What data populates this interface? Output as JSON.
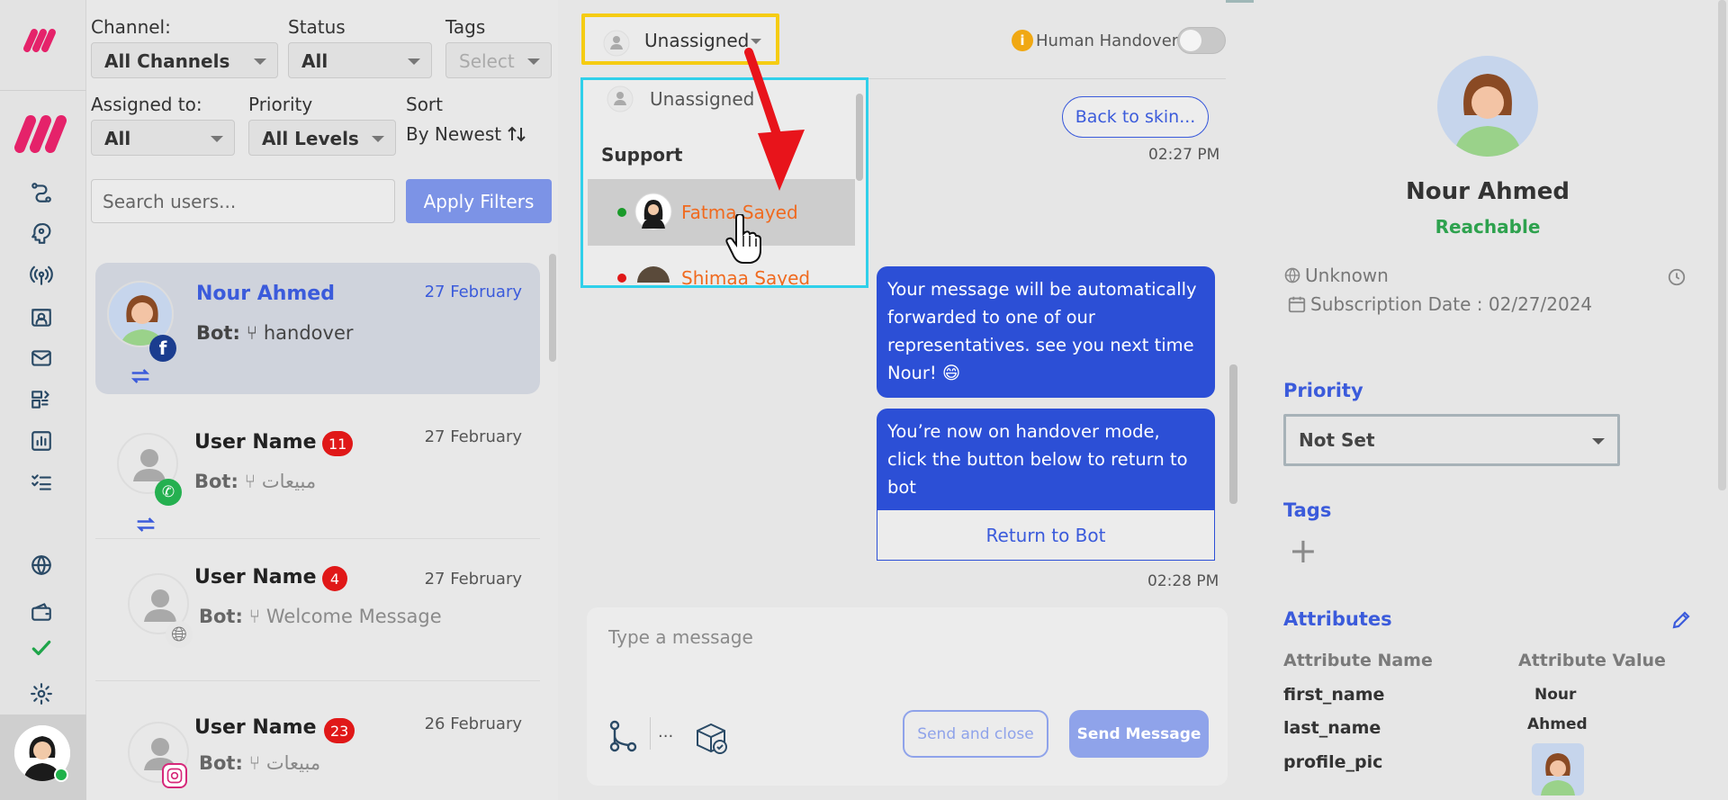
{
  "filters": {
    "channel_label": "Channel:",
    "channel_value": "All Channels",
    "status_label": "Status",
    "status_value": "All",
    "tags_label": "Tags",
    "tags_value": "Select",
    "assigned_label": "Assigned to:",
    "assigned_value": "All",
    "priority_label": "Priority",
    "priority_value": "All Levels",
    "sort_label": "Sort",
    "sort_value": "By Newest",
    "search_placeholder": "Search users...",
    "apply_label": "Apply Filters"
  },
  "conversations": [
    {
      "name": "Nour Ahmed",
      "date": "27 February",
      "bot_prefix": "Bot:",
      "bot_text": "handover",
      "channel": "facebook-icon",
      "active": true
    },
    {
      "name": "User Name",
      "date": "27 February",
      "count": "11",
      "bot_prefix": "Bot:",
      "bot_text": "مبيعات",
      "channel": "whatsapp-icon"
    },
    {
      "name": "User Name",
      "date": "27 February",
      "count": "4",
      "bot_prefix": "Bot:",
      "bot_text": "Welcome Message",
      "channel": "globe-icon"
    },
    {
      "name": "User Name",
      "date": "26 February",
      "count": "23",
      "bot_prefix": "Bot:",
      "bot_text": "مبيعات",
      "channel": "instagram-icon"
    }
  ],
  "chat": {
    "assign_value": "Unassigned",
    "handover_label": "Human Handover",
    "dropdown": {
      "unassigned": "Unassigned",
      "group": "Support",
      "agents": [
        {
          "name": "Fatma Sayed",
          "status": "online"
        },
        {
          "name": "Shimaa Sayed",
          "status": "offline"
        }
      ]
    },
    "back_button": "Back to skin...",
    "time1": "02:27 PM",
    "msg1": "Your message will be automatically forwarded to one of our representatives. see you next time Nour! 😄",
    "msg2": "You’re now on handover mode, click the button below to return to bot",
    "return_button": "Return to Bot",
    "time2": "02:28 PM",
    "input_placeholder": "Type a message",
    "more": "...",
    "send_close": "Send and close",
    "send_message": "Send Message"
  },
  "profile": {
    "name": "Nour Ahmed",
    "status": "Reachable",
    "location": "Unknown",
    "subscription": "Subscription Date : 02/27/2024",
    "priority_title": "Priority",
    "priority_value": "Not Set",
    "tags_title": "Tags",
    "attributes_title": "Attributes",
    "attr_name_header": "Attribute Name",
    "attr_value_header": "Attribute Value",
    "attributes": [
      {
        "name": "first_name",
        "value": "Nour"
      },
      {
        "name": "last_name",
        "value": "Ahmed"
      },
      {
        "name": "profile_pic",
        "value": ""
      }
    ]
  },
  "colors": {
    "accent": "#2c4fd6",
    "highlight_border": "#f5cc13",
    "dropdown_border": "#2fd0ea",
    "reachable": "#2ea24e",
    "agent_name": "#f06a1f",
    "annotation_arrow": "#e8141b"
  }
}
